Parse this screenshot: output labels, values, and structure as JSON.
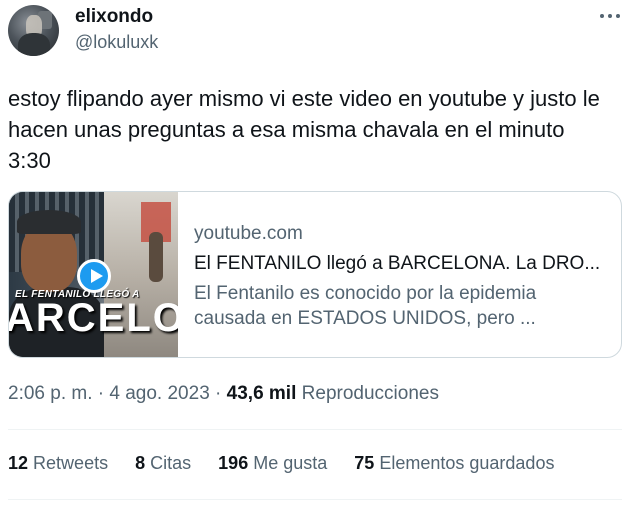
{
  "author": {
    "name": "elixondo",
    "handle": "@lokuluxk"
  },
  "tweet": {
    "text": "estoy flipando ayer mismo vi este video en youtube y justo le\nhacen unas preguntas a esa misma chavala en el minuto\n3:30"
  },
  "card": {
    "domain": "youtube.com",
    "title": "El FENTANILO llegó a BARCELONA. La DRO...",
    "description": "El Fentanilo es conocido por la epidemia causada en ESTADOS UNIDOS, pero ...",
    "thumbnail_headline": "EL FENTANILO LLEGÓ A",
    "thumbnail_big": "ARCELON"
  },
  "meta": {
    "time": "2:06 p. m.",
    "sep1": "·",
    "date": "4 ago. 2023",
    "sep2": "·",
    "views": "43,6 mil",
    "views_label": "Reproducciones"
  },
  "stats": {
    "retweets": "12",
    "retweets_label": "Retweets",
    "quotes": "8",
    "quotes_label": "Citas",
    "likes": "196",
    "likes_label": "Me gusta",
    "bookmarks": "75",
    "bookmarks_label": "Elementos guardados"
  },
  "colors": {
    "text": "#0f1419",
    "secondary": "#536471",
    "border": "#cfd9de",
    "accent": "#1d9bf0"
  },
  "icons": {
    "more": "more-horizontal-icon",
    "play": "play-icon"
  }
}
